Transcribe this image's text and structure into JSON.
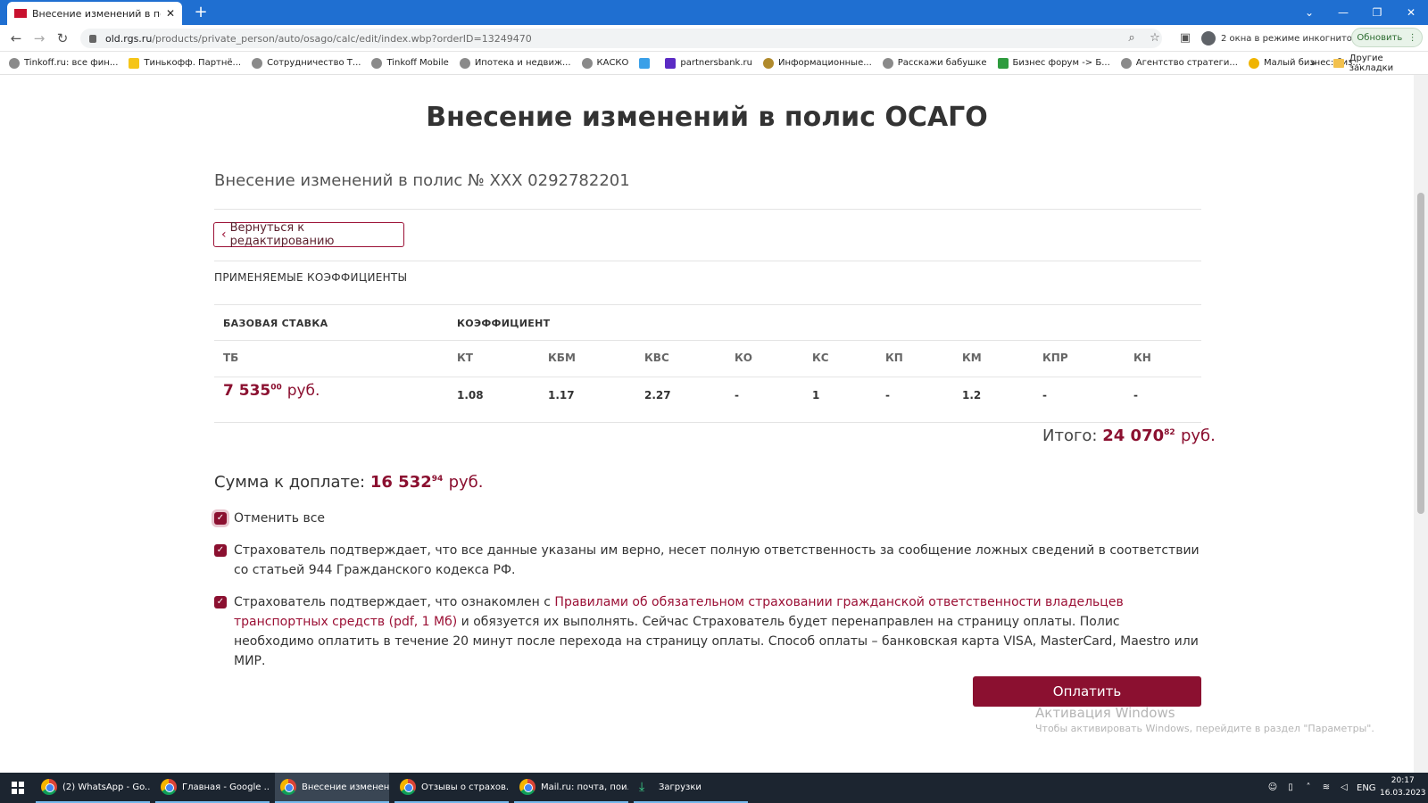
{
  "browser": {
    "tab_title": "Внесение изменений в полис О",
    "url_host": "old.rgs.ru",
    "url_path": "/products/private_person/auto/osago/calc/edit/index.wbp?orderID=13249470",
    "incognito_label": "2 окна в режиме инкогнито",
    "update_label": "Обновить",
    "bookmarks": [
      "Tinkoff.ru: все фин...",
      "Тинькофф. Партнё...",
      "Сотрудничество Т...",
      "Tinkoff Mobile",
      "Ипотека и недвиж...",
      "КАСКО",
      "",
      "partnersbank.ru",
      "Информационные...",
      "Расскажи бабушке",
      "Бизнес форум -> Б...",
      "Агентство стратеги...",
      "Малый бизнес: биз..."
    ],
    "bookmarks_more": "»",
    "other_bookmarks": "Другие закладки"
  },
  "page": {
    "title": "Внесение изменений в полис ОСАГО",
    "subtitle": "Внесение изменений в полис № XXX 0292782201",
    "back_button": "Вернуться к редактированию",
    "section_label": "ПРИМЕНЯЕМЫЕ КОЭФФИЦИЕНТЫ",
    "table": {
      "group_headers": [
        "БАЗОВАЯ СТАВКА",
        "КОЭФФИЦИЕНТ"
      ],
      "columns": [
        "ТБ",
        "КТ",
        "КБМ",
        "КВС",
        "КО",
        "КС",
        "КП",
        "КМ",
        "КПР",
        "КН"
      ],
      "base_int": "7 535",
      "base_dec": "00",
      "base_cur": "руб.",
      "values": [
        "1.08",
        "1.17",
        "2.27",
        "-",
        "1",
        "-",
        "1.2",
        "-",
        "-"
      ]
    },
    "total": {
      "label": "Итого:",
      "int": "24 070",
      "dec": "82",
      "cur": "руб."
    },
    "to_pay": {
      "label": "Сумма к доплате:",
      "int": "16 532",
      "dec": "94",
      "cur": "руб."
    },
    "checkbox_all": "Отменить все",
    "checkbox_1": "Страхователь подтверждает, что все данные указаны им верно, несет полную ответственность за сообщение ложных сведений в соответствии со статьей 944 Гражданского кодекса РФ.",
    "checkbox_2_pre": "Страхователь подтверждает, что ознакомлен с ",
    "checkbox_2_link": "Правилами об обязательном страховании гражданской ответственности владельцев транспортных средств (pdf, 1 Мб)",
    "checkbox_2_post": " и обязуется их выполнять. Сейчас Страхователь будет перенаправлен на страницу оплаты. Полис необходимо оплатить в течение 20 минут после перехода на страницу оплаты. Способ оплаты – банковская карта VISA, MasterCard, Maestro или МИР.",
    "pay_button": "Оплатить"
  },
  "watermark": {
    "line1": "Активация Windows",
    "line2": "Чтобы активировать Windows, перейдите в раздел \"Параметры\"."
  },
  "taskbar": {
    "apps": [
      "(2) WhatsApp - Go...",
      "Главная - Google ...",
      "Внесение изменен...",
      "Отзывы о страхов...",
      "Mail.ru: почта, пои...",
      "Загрузки"
    ],
    "lang": "ENG",
    "time": "20:17",
    "date": "16.03.2023"
  },
  "colors": {
    "accent": "#8b1030",
    "chrome_blue": "#1f6fd1",
    "taskbar": "#1c2530"
  }
}
